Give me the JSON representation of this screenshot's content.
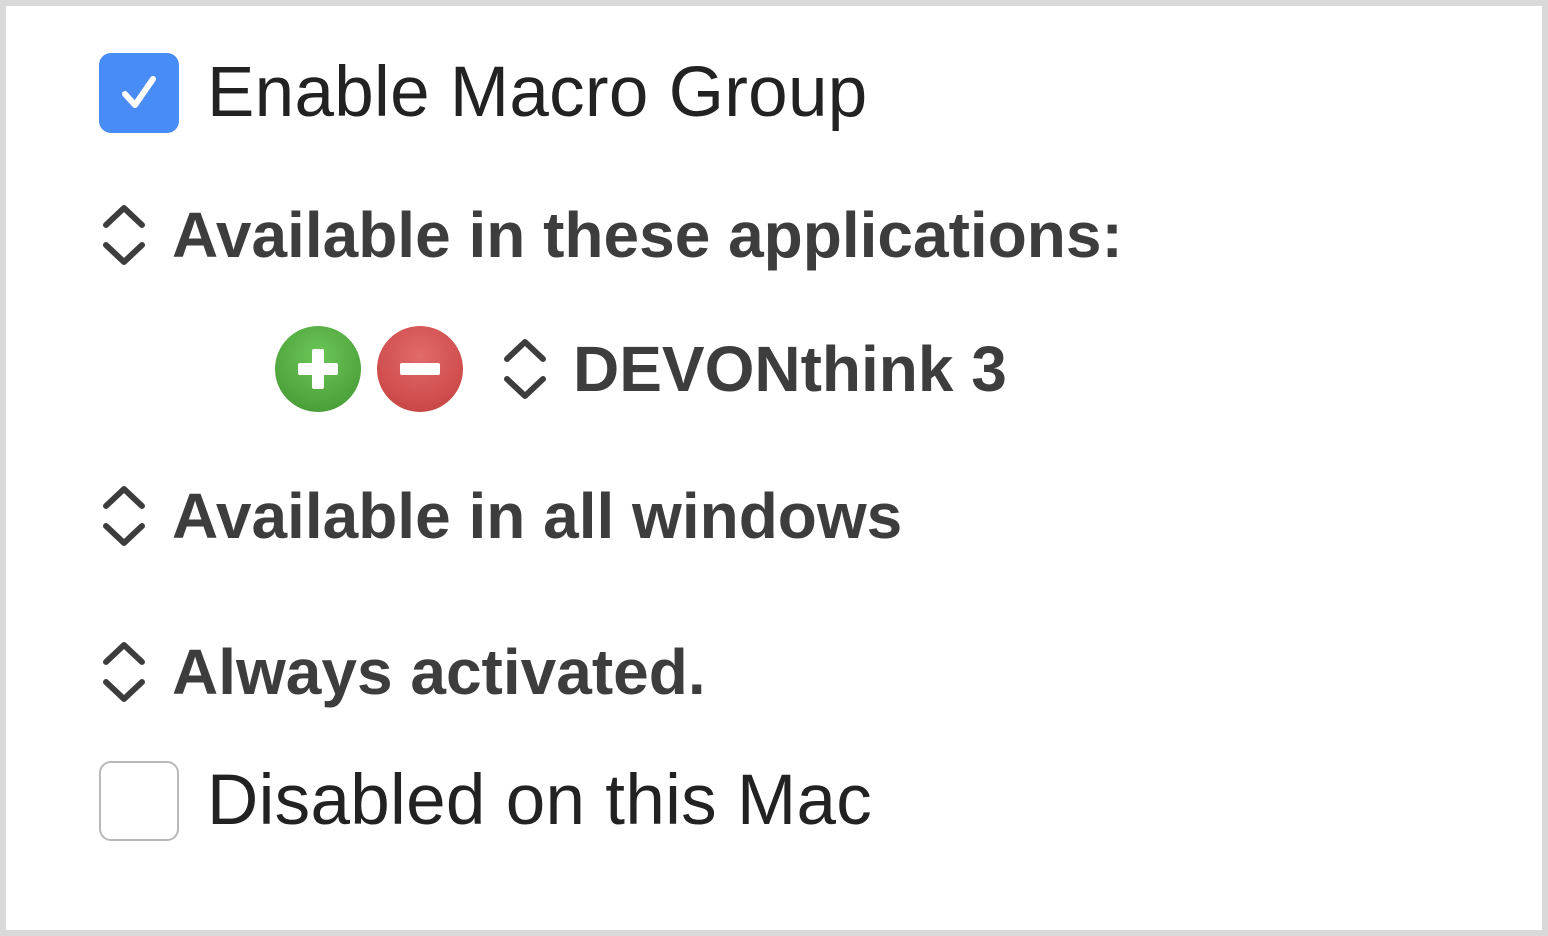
{
  "enable_group": {
    "label": "Enable Macro Group",
    "checked": true
  },
  "availability": {
    "apps_popup_label": "Available in these applications:",
    "application": "DEVONthink 3",
    "windows_popup_label": "Available in all windows",
    "activation_popup_label": "Always activated."
  },
  "disabled_on_mac": {
    "label": "Disabled on this Mac",
    "checked": false
  },
  "colors": {
    "checkbox_on": "#4a8cf7",
    "add_button": "#4ea43c",
    "remove_button": "#cf4b4b"
  },
  "icons": {
    "checkmark": "checkmark-icon",
    "stepper": "updown-chevron-icon",
    "add": "plus-icon",
    "remove": "minus-icon"
  }
}
